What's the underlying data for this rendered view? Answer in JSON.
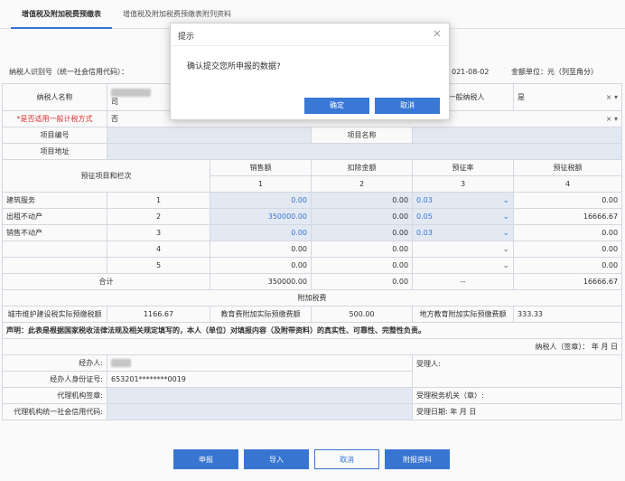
{
  "tabs": [
    "增值税及附加税费预缴表",
    "增值税及附加税费预缴表附列资料"
  ],
  "info": {
    "taxpayer_id_label": "纳税人识别号（统一社会信用代码）：",
    "date": "021-08-02",
    "unit": "金额单位：元（列至角分）"
  },
  "form": {
    "taxpayer_name_label": "纳税人名称",
    "taxpayer_name_suffix": "司",
    "general_taxpayer_label": "税一般纳税人",
    "general_taxpayer_value": "是",
    "general_method_label": "*是否适用一般计税方式",
    "general_method_value": "否",
    "project_no_label": "项目编号",
    "project_name_label": "项目名称",
    "project_addr_label": "项目地址",
    "prepay_items_label": "预征项目和栏次",
    "col_sales": "销售额",
    "col_deduct": "扣除金额",
    "col_rate": "预征率",
    "col_tax": "预征税额",
    "col_n1": "1",
    "col_n2": "2",
    "col_n3": "3",
    "col_n4": "4",
    "rows": [
      {
        "name": "建筑服务",
        "no": "1",
        "sales": "0.00",
        "deduct": "0.00",
        "rate": "0.03",
        "tax": "0.00"
      },
      {
        "name": "出租不动产",
        "no": "2",
        "sales": "350000.00",
        "deduct": "0.00",
        "rate": "0.05",
        "tax": "16666.67"
      },
      {
        "name": "销售不动产",
        "no": "3",
        "sales": "0.00",
        "deduct": "0.00",
        "rate": "0.03",
        "tax": "0.00"
      },
      {
        "name": "",
        "no": "4",
        "sales": "0.00",
        "deduct": "0.00",
        "rate": "",
        "tax": "0.00"
      },
      {
        "name": "",
        "no": "5",
        "sales": "0.00",
        "deduct": "0.00",
        "rate": "",
        "tax": "0.00"
      }
    ],
    "total_label": "合计",
    "total_sales": "350000.00",
    "total_deduct": "0.00",
    "total_rate": "--",
    "total_tax": "16666.67",
    "surcharge_header": "附加税费",
    "city_tax_label": "城市维护建设税实际预缴税额",
    "city_tax_value": "1166.67",
    "edu_label": "教育费附加实际预缴费额",
    "edu_value": "500.00",
    "local_edu_label": "地方教育附加实际预缴费额",
    "local_edu_value": "333.33",
    "declaration": "声明：此表是根据国家税收法律法规及相关规定填写的，本人（单位）对填报内容（及附带资料）的真实性、可靠性、完整性负责。",
    "signature": "纳税人（签章）：   年   月   日",
    "handler_label": "经办人:",
    "receiver_label": "受理人:",
    "handler_id_label": "经办人身份证号:",
    "handler_id_value": "653201********0019",
    "agent_seal_label": "代理机构签章:",
    "tax_office_label": "受理税务机关（章）:",
    "agent_credit_label": "代理机构统一社会信用代码:",
    "accept_date_label": "受理日期:   年   月   日"
  },
  "buttons": {
    "declare": "申报",
    "import": "导入",
    "cancel": "取消",
    "attach": "附报资料"
  },
  "dialog": {
    "title": "提示",
    "message": "确认提交您所申报的数据?",
    "ok": "确定",
    "cancel": "取消",
    "close": "×"
  }
}
